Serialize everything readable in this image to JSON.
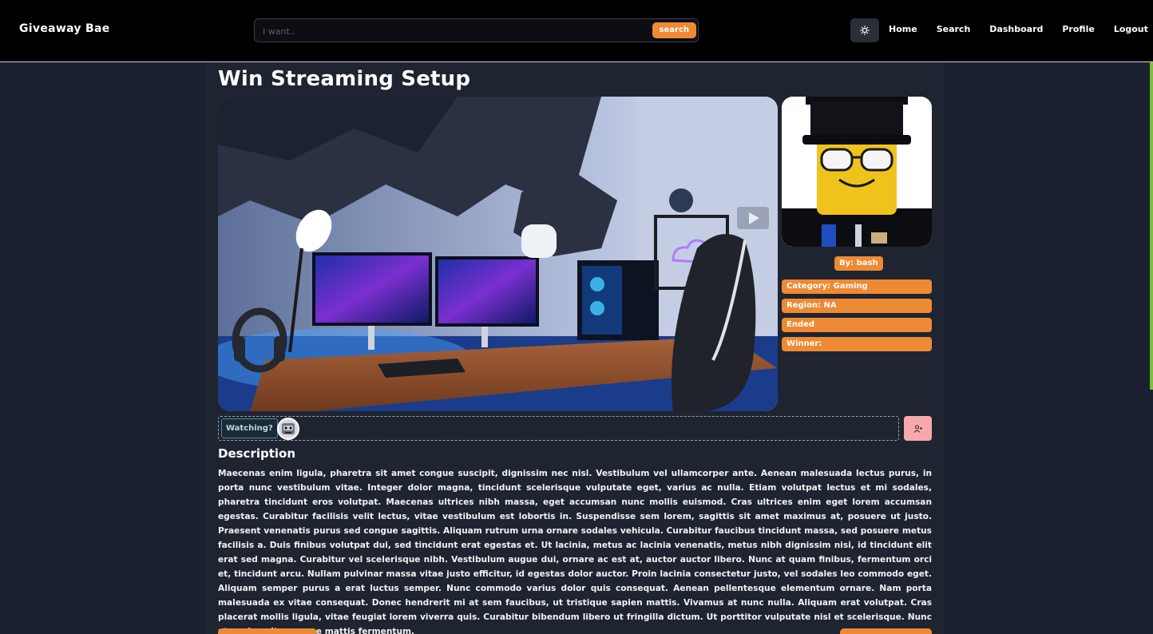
{
  "navbar": {
    "brand": "Giveaway Bae",
    "search_placeholder": "I want..",
    "search_button": "search",
    "links": [
      "Home",
      "Search",
      "Dashboard",
      "Profile",
      "Logout"
    ]
  },
  "giveaway": {
    "title": "Win Streaming Setup",
    "author": "By: bash",
    "category": "Category: Gaming",
    "region": "Region: NA",
    "status": "Ended",
    "winner": "Winner:"
  },
  "watching": {
    "label": "Watching?"
  },
  "description": {
    "heading": "Description",
    "body": "Maecenas enim ligula, pharetra sit amet congue suscipit, dignissim nec nisl. Vestibulum vel ullamcorper ante. Aenean malesuada lectus purus, in porta nunc vestibulum vitae. Integer dolor magna, tincidunt scelerisque vulputate eget, varius ac nulla. Etiam volutpat lectus et mi sodales, pharetra tincidunt eros volutpat. Maecenas ultrices nibh massa, eget accumsan nunc mollis euismod. Cras ultrices enim eget lorem accumsan egestas. Curabitur facilisis velit lectus, vitae vestibulum est lobortis in. Suspendisse sem lorem, sagittis sit amet maximus at, posuere ut justo. Praesent venenatis purus sed congue sagittis. Aliquam rutrum urna ornare sodales vehicula. Curabitur faucibus tincidunt massa, sed posuere metus facilisis a. Duis finibus volutpat dui, sed tincidunt erat egestas et. Ut lacinia, metus ac lacinia venenatis, metus nibh dignissim nisi, id tincidunt elit erat sed magna. Curabitur vel scelerisque nibh. Vestibulum augue dui, ornare ac est at, auctor auctor libero. Nunc at quam finibus, fermentum orci et, tincidunt arcu. Nullam pulvinar massa vitae justo efficitur, id egestas dolor auctor. Proin lacinia consectetur justo, vel sodales leo commodo eget. Aliquam semper purus a erat luctus semper. Nunc commodo varius dolor quis consequat. Aenean pellentesque elementum ornare. Nam porta malesuada ex vitae consequat. Donec hendrerit mi at sem faucibus, ut tristique sapien mattis. Vivamus at nunc nulla. Aliquam erat volutpat. Cras placerat mollis ligula, vitae feugiat lorem viverra quis. Curabitur bibendum libero ut fringilla dictum. Ut porttitor vulputate nisl et scelerisque. Nunc ut sapien vitae augue mattis fermentum."
  },
  "icons": {
    "theme": "sun-icon",
    "follow": "add-user-icon"
  },
  "colors": {
    "accent": "#ee8a33",
    "navbar": "#000000",
    "background": "#1b2130",
    "follow_button": "#f7a8ad"
  }
}
